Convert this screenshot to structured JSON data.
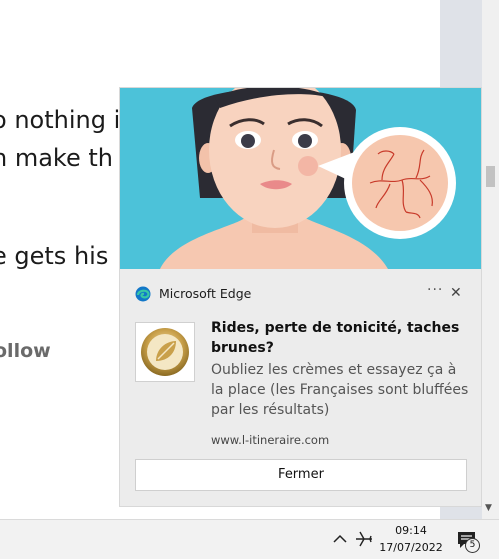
{
  "background_page": {
    "lines": [
      "o nothing i",
      "n make th",
      "e gets his"
    ],
    "follow_label": "ollow"
  },
  "notification": {
    "app_name": "Microsoft Edge",
    "more_icon": "more-options-icon",
    "close_icon": "close-icon",
    "title": "Rides, perte de tonicité, taches brunes?",
    "text": "Oubliez les crèmes et essayez ça à la place (les Françaises sont bluffées par les résultats)",
    "source": "www.l-itineraire.com",
    "button_label": "Fermer",
    "hero_background": "#4cc2d9",
    "card_background": "#ececec"
  },
  "taskbar": {
    "time": "09:14",
    "date": "17/07/2022",
    "notification_count": "5"
  }
}
